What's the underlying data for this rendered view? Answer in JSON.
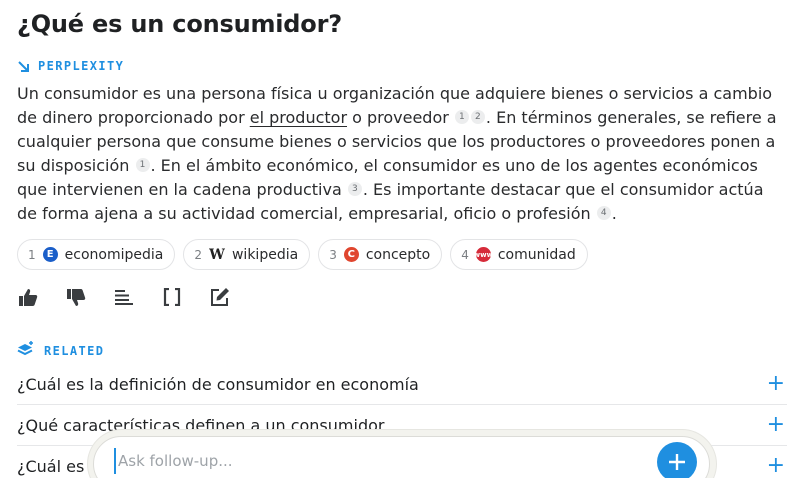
{
  "page": {
    "title": "¿Qué es un consumidor?",
    "source_label": "PERPLEXITY"
  },
  "answer": {
    "p1": "Un consumidor es una persona física u organización que adquiere bienes o servicios a cambio de dinero proporcionado por ",
    "link": "el productor",
    "p2": " o proveedor",
    "p3": ". En términos generales, se refiere a cualquier persona que consume bienes o servicios que los productores o proveedores ponen a su disposición",
    "p4": ". En el ámbito económico, el consumidor es uno de los agentes económicos que intervienen en la cadena productiva",
    "p5": ". Es importante destacar que el consumidor actúa de forma ajena a su actividad comercial, empresarial, oficio o profesión",
    "p6": ".",
    "c1": "1",
    "c2": "2",
    "c3": "1",
    "c4": "3",
    "c5": "4"
  },
  "sources": [
    {
      "num": "1",
      "name": "economipedia",
      "icon": "economipedia-favicon",
      "glyph": "E"
    },
    {
      "num": "2",
      "name": "wikipedia",
      "icon": "wikipedia-favicon",
      "glyph": "W"
    },
    {
      "num": "3",
      "name": "concepto",
      "icon": "concepto-favicon",
      "glyph": "C"
    },
    {
      "num": "4",
      "name": "comunidad",
      "icon": "comunidad-favicon",
      "glyph": "www"
    }
  ],
  "actions": [
    "thumbs-up-icon",
    "thumbs-down-icon",
    "list-icon",
    "brackets-icon",
    "edit-icon"
  ],
  "related": {
    "label": "RELATED",
    "items": [
      {
        "q": "¿Cuál es la definición de consumidor en economía"
      },
      {
        "q": "¿Qué características definen a un consumidor"
      },
      {
        "q": "¿Cuál es"
      }
    ]
  },
  "followup": {
    "placeholder": "Ask follow-up..."
  },
  "colors": {
    "accent": "#1f8fe0",
    "text": "#2a2b2d"
  }
}
